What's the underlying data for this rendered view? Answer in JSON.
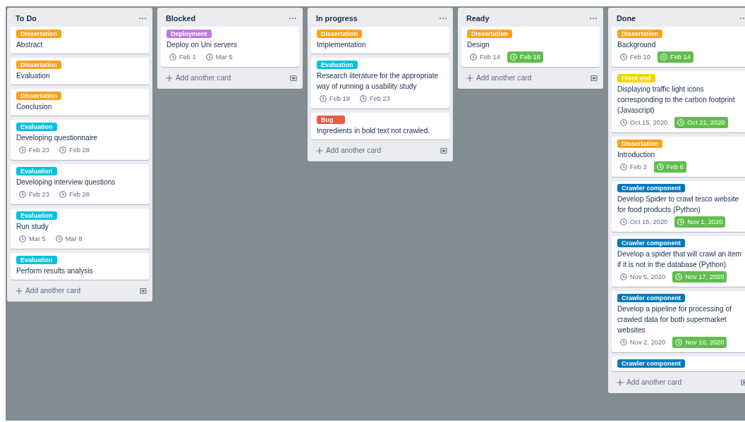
{
  "lists": [
    {
      "title": "To Do",
      "cards": [
        {
          "label": {
            "text": "DIssertation",
            "color": "#ff9f1a"
          },
          "title": "Abstract"
        },
        {
          "label": {
            "text": "DIssertation",
            "color": "#ff9f1a"
          },
          "title": "Evaluation"
        },
        {
          "label": {
            "text": "DIssertation",
            "color": "#ff9f1a"
          },
          "title": "Conclusion"
        },
        {
          "label": {
            "text": "Evaluation",
            "color": "#00c2e0"
          },
          "title": "Developing questionnaire",
          "dates": [
            {
              "text": "Feb 23",
              "complete": false
            },
            {
              "text": "Feb 28",
              "complete": false
            }
          ]
        },
        {
          "label": {
            "text": "Evaluation",
            "color": "#00c2e0"
          },
          "title": "Developing interview questions",
          "dates": [
            {
              "text": "Feb 23",
              "complete": false
            },
            {
              "text": "Feb 28",
              "complete": false
            }
          ]
        },
        {
          "label": {
            "text": "Evaluation",
            "color": "#00c2e0"
          },
          "title": "Run study",
          "dates": [
            {
              "text": "Mar 5",
              "complete": false
            },
            {
              "text": "Mar 8",
              "complete": false
            }
          ]
        },
        {
          "label": {
            "text": "Evaluation",
            "color": "#00c2e0"
          },
          "title": "Perform results analysis"
        }
      ],
      "add_card": "Add another card"
    },
    {
      "title": "Blocked",
      "cards": [
        {
          "label": {
            "text": "Deployment",
            "color": "#c377e0"
          },
          "title": "Deploy on Uni servers",
          "dates": [
            {
              "text": "Feb 1",
              "complete": false
            },
            {
              "text": "Mar 5",
              "complete": false
            }
          ]
        }
      ],
      "add_card": "Add another card"
    },
    {
      "title": "In progress",
      "cards": [
        {
          "label": {
            "text": "DIssertation",
            "color": "#ff9f1a"
          },
          "title": "Implementation"
        },
        {
          "label": {
            "text": "Evaluation",
            "color": "#00c2e0"
          },
          "title": "Research literature for the appropriate way of running a usability study",
          "dates": [
            {
              "text": "Feb 19",
              "complete": false
            },
            {
              "text": "Feb 23",
              "complete": false
            }
          ]
        },
        {
          "label": {
            "text": "Bug",
            "color": "#eb5a46"
          },
          "title": "Ingredients in bold text not crawled."
        }
      ],
      "add_card": "Add another card"
    },
    {
      "title": "Ready",
      "cards": [
        {
          "label": {
            "text": "DIssertation",
            "color": "#ff9f1a"
          },
          "title": "Design",
          "dates": [
            {
              "text": "Feb 14",
              "complete": false
            },
            {
              "text": "Feb 16",
              "complete": true
            }
          ]
        }
      ],
      "add_card": "Add another card"
    },
    {
      "title": "Done",
      "cards": [
        {
          "label": {
            "text": "DIssertation",
            "color": "#ff9f1a"
          },
          "title": "Background",
          "dates": [
            {
              "text": "Feb 10",
              "complete": false
            },
            {
              "text": "Feb 14",
              "complete": true
            }
          ]
        },
        {
          "label": {
            "text": "Front end",
            "color": "#f2d600"
          },
          "title": "Displaying traffic light icons corresponding to the carbon footprint (Javascript)",
          "dates": [
            {
              "text": "Oct 15, 2020",
              "complete": false
            },
            {
              "text": "Oct 21, 2020",
              "complete": true
            }
          ]
        },
        {
          "label": {
            "text": "DIssertation",
            "color": "#ff9f1a"
          },
          "title": "Introduction",
          "dates": [
            {
              "text": "Feb 3",
              "complete": false
            },
            {
              "text": "Feb 6",
              "complete": true
            }
          ]
        },
        {
          "label": {
            "text": "Crawler component",
            "color": "#0079bf"
          },
          "title": "Develop Spider to crawl tesco website for food products (Python)",
          "dates": [
            {
              "text": "Oct 15, 2020",
              "complete": false
            },
            {
              "text": "Nov 1, 2020",
              "complete": true
            }
          ]
        },
        {
          "label": {
            "text": "Crawler component",
            "color": "#0079bf"
          },
          "title": "Develop a spider that will crawl an item if it is not in the database (Python)",
          "dates": [
            {
              "text": "Nov 5, 2020",
              "complete": false
            },
            {
              "text": "Nov 17, 2020",
              "complete": true
            }
          ]
        },
        {
          "label": {
            "text": "Crawler component",
            "color": "#0079bf"
          },
          "title": "Develop a pipeline for processing of crawled data for both supermarket websites",
          "dates": [
            {
              "text": "Nov 2, 2020",
              "complete": false
            },
            {
              "text": "Nov 10, 2020",
              "complete": true
            }
          ]
        },
        {
          "label": {
            "text": "Crawler component",
            "color": "#0079bf"
          }
        }
      ],
      "add_card": "Add another card"
    }
  ]
}
